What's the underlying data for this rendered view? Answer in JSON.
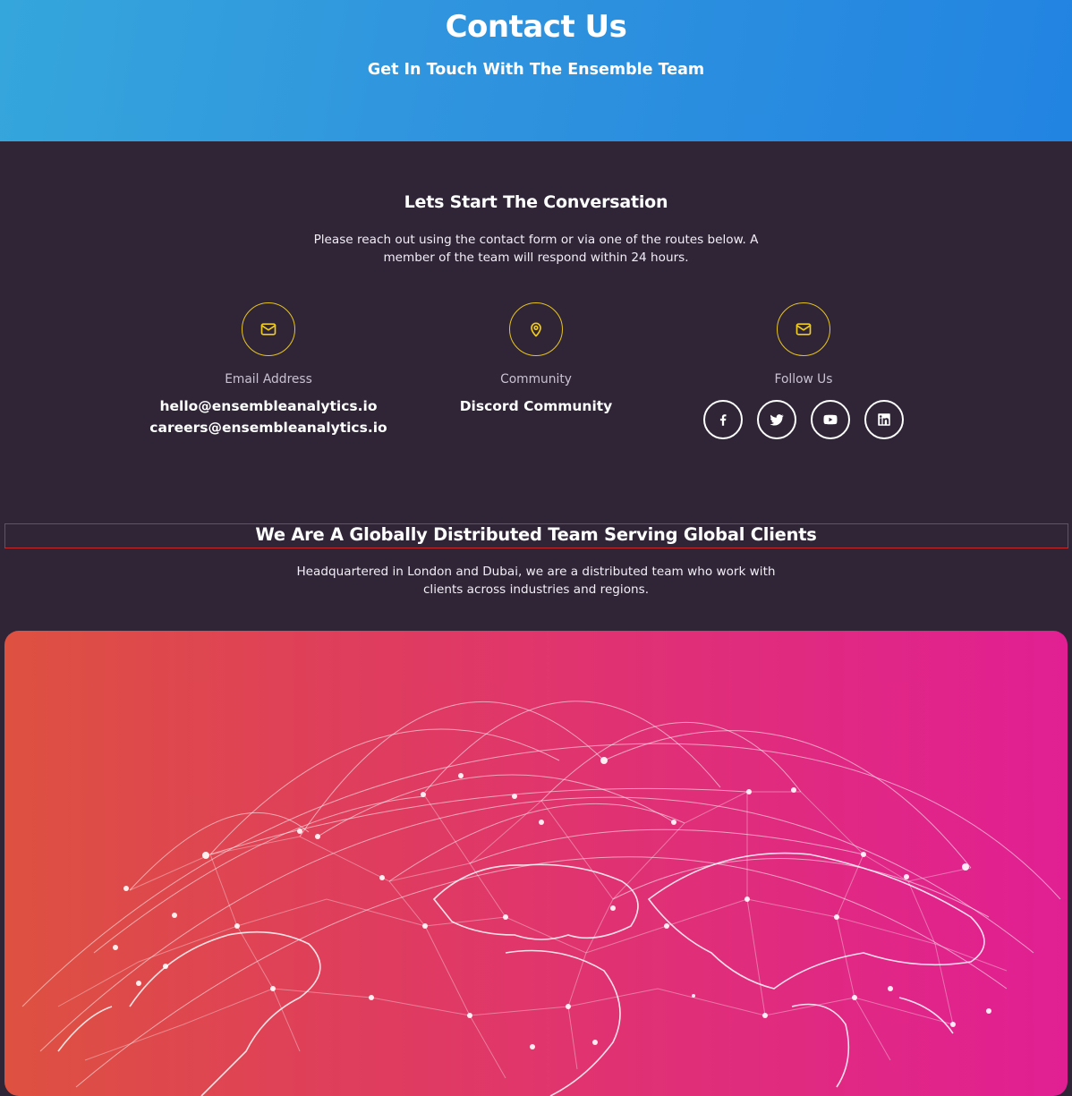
{
  "hero": {
    "title": "Contact Us",
    "subtitle": "Get In Touch With The Ensemble Team"
  },
  "conversation": {
    "title": "Lets Start The Conversation",
    "intro": "Please reach out using the contact form or via one of the routes below. A member of the team will respond within 24 hours."
  },
  "contact_columns": [
    {
      "icon": "mail-icon",
      "label": "Email Address",
      "values": [
        "hello@ensembleanalytics.io",
        "careers@ensembleanalytics.io"
      ]
    },
    {
      "icon": "map-pin-icon",
      "label": "Community",
      "values": [
        "Discord Community"
      ]
    },
    {
      "icon": "mail-icon",
      "label": "Follow Us",
      "socials": [
        "facebook-icon",
        "twitter-icon",
        "youtube-icon",
        "linkedin-icon"
      ]
    }
  ],
  "global": {
    "title": "We Are A Globally Distributed Team Serving Global Clients",
    "intro": "Headquartered in London and Dubai, we are a distributed team who work with clients across industries and regions."
  },
  "colors": {
    "hero_gradient": [
      "#35a6dc",
      "#2284e1"
    ],
    "page_background": "#2f2537",
    "icon_ring": "#e7c41e",
    "map_gradient": [
      "#de5140",
      "#e11f93"
    ]
  }
}
